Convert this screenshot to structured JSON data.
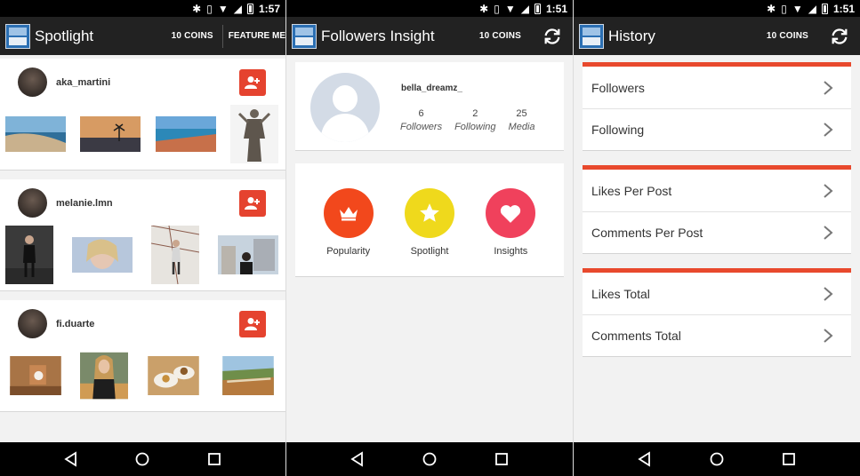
{
  "status": {
    "times": [
      "1:57",
      "1:51",
      "1:51"
    ]
  },
  "screens": {
    "spotlight": {
      "title": "Spotlight",
      "coins": "10 COINS",
      "feature": "FEATURE ME",
      "posts": [
        {
          "username": "aka_martini"
        },
        {
          "username": "melanie.lmn"
        },
        {
          "username": "fi.duarte"
        }
      ]
    },
    "insight": {
      "title": "Followers Insight",
      "coins": "10 COINS",
      "profile": {
        "username": "bella_dreamz_",
        "stats": [
          {
            "value": "6",
            "label": "Followers"
          },
          {
            "value": "2",
            "label": "Following"
          },
          {
            "value": "25",
            "label": "Media"
          }
        ]
      },
      "features": [
        {
          "label": "Popularity",
          "color": "#f2481c",
          "icon": "crown-icon"
        },
        {
          "label": "Spotlight",
          "color": "#efd91c",
          "icon": "star-icon"
        },
        {
          "label": "Insights",
          "color": "#f0415c",
          "icon": "heart-icon"
        }
      ]
    },
    "history": {
      "title": "History",
      "coins": "10 COINS",
      "groups": [
        {
          "items": [
            "Followers",
            "Following"
          ]
        },
        {
          "items": [
            "Likes Per Post",
            "Comments Per Post"
          ]
        },
        {
          "items": [
            "Likes Total",
            "Comments Total"
          ]
        }
      ]
    }
  },
  "colors": {
    "accent": "#e8492d",
    "appbar": "#222222",
    "add_button": "#e5432f"
  }
}
